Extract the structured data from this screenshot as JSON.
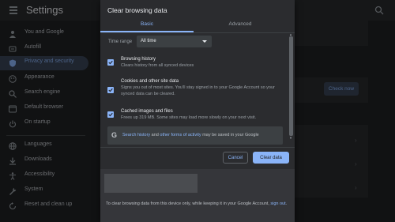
{
  "settings": {
    "title": "Settings",
    "nav": [
      {
        "label": "You and Google",
        "icon": "person-icon",
        "active": false
      },
      {
        "label": "Autofill",
        "icon": "autofill-icon",
        "active": false
      },
      {
        "label": "Privacy and security",
        "icon": "shield-icon",
        "active": true
      },
      {
        "label": "Appearance",
        "icon": "palette-icon",
        "active": false
      },
      {
        "label": "Search engine",
        "icon": "search-icon",
        "active": false
      },
      {
        "label": "Default browser",
        "icon": "browser-icon",
        "active": false
      },
      {
        "label": "On startup",
        "icon": "power-icon",
        "active": false
      },
      {
        "label": "Languages",
        "icon": "globe-icon",
        "active": false
      },
      {
        "label": "Downloads",
        "icon": "download-icon",
        "active": false
      },
      {
        "label": "Accessibility",
        "icon": "accessibility-icon",
        "active": false
      },
      {
        "label": "System",
        "icon": "wrench-icon",
        "active": false
      },
      {
        "label": "Reset and clean up",
        "icon": "reset-icon",
        "active": false
      }
    ],
    "check_now_label": "Check now"
  },
  "dialog": {
    "title": "Clear browsing data",
    "tabs": {
      "basic": "Basic",
      "advanced": "Advanced"
    },
    "time_range": {
      "label": "Time range",
      "value": "All time"
    },
    "options": [
      {
        "title": "Browsing history",
        "desc": "Clears history from all synced devices",
        "checked": true
      },
      {
        "title": "Cookies and other site data",
        "desc": "Signs you out of most sites. You'll stay signed in to your Google Account so your synced data can be cleared.",
        "checked": true
      },
      {
        "title": "Cached images and files",
        "desc": "Frees up 319 MB. Some sites may load more slowly on your next visit.",
        "checked": true
      }
    ],
    "google_card": {
      "link1": "Search history",
      "mid": " and ",
      "link2": "other forms of activity",
      "rest": " may be saved in your Google"
    },
    "buttons": {
      "cancel": "Cancel",
      "clear": "Clear data"
    },
    "footer": {
      "text": "To clear browsing data from this device only, while keeping it in your Google Account, ",
      "link": "sign out",
      "end": "."
    }
  },
  "colors": {
    "accent": "#8ab4f8",
    "background": "#202124",
    "dialog": "#2b2c2f"
  }
}
